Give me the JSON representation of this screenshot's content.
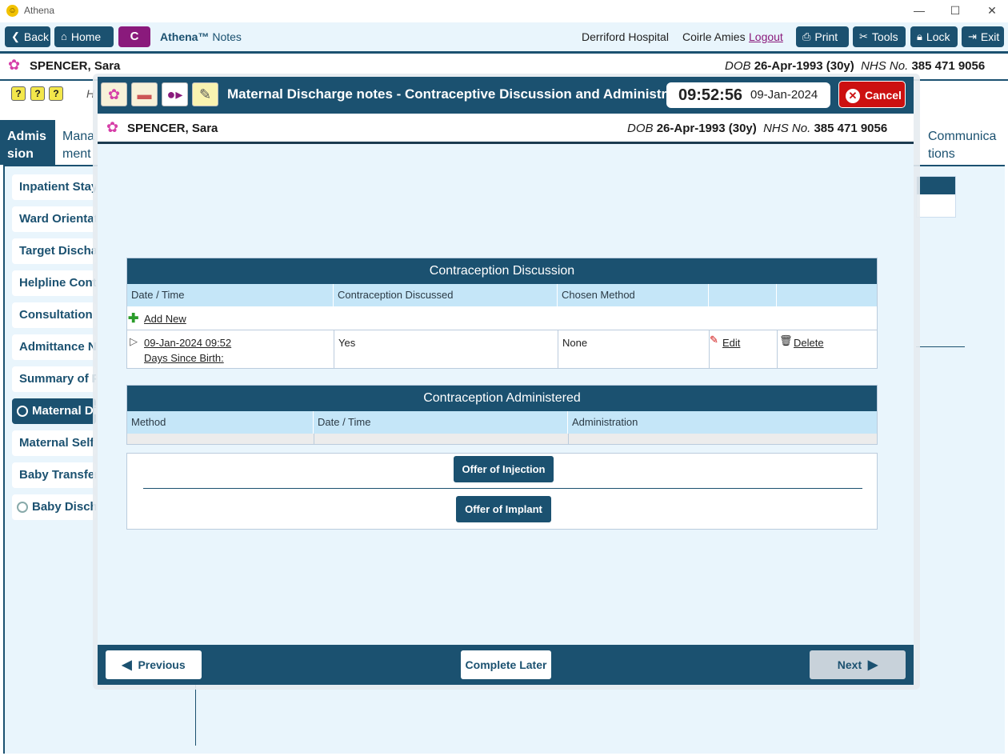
{
  "window": {
    "title": "Athena",
    "minimize": "—",
    "maximize": "☐",
    "close": "✕"
  },
  "toolbar": {
    "back": "Back",
    "home": "Home",
    "c_label": "C",
    "brand": "Athena™",
    "brand_suffix": "Notes",
    "hospital": "Derriford Hospital",
    "user": "Coirle Amies",
    "logout": "Logout",
    "print": "Print",
    "tools": "Tools",
    "lock": "Lock",
    "exit": "Exit"
  },
  "patient": {
    "name": "SPENCER, Sara",
    "dob_label": "DOB",
    "dob": "26-Apr-1993 (30y)",
    "nhs_label": "NHS No.",
    "nhs": "385 471 9056"
  },
  "tabs": {
    "admission": "Admis sion",
    "management": "Mana ment",
    "communications": "Communica tions"
  },
  "behind_heading": "H",
  "sidebar": {
    "items": [
      {
        "label": "Inpatient Stay"
      },
      {
        "label": "Ward Orientat"
      },
      {
        "label": "Target Dischar"
      },
      {
        "label": "Helpline Cont"
      },
      {
        "label": "Consultation I"
      },
      {
        "label": "Admittance N"
      },
      {
        "label": "Summary of P"
      },
      {
        "label": "Maternal Di"
      },
      {
        "label": "Maternal Self"
      },
      {
        "label": "Baby Transfer"
      },
      {
        "label": "Baby Discha"
      }
    ]
  },
  "modal": {
    "title": "Maternal Discharge notes - Contraceptive Discussion and Administration",
    "time": "09:52:56",
    "date": "09-Jan-2024",
    "cancel": "Cancel",
    "discussion": {
      "heading": "Contraception Discussion",
      "columns": [
        "Date / Time",
        "Contraception Discussed",
        "Chosen Method",
        "",
        ""
      ],
      "add_new": "Add New",
      "row": {
        "datetime": "09-Jan-2024 09:52",
        "days_since_birth": "Days Since Birth:",
        "discussed": "Yes",
        "method": "None",
        "edit": "Edit",
        "delete": "Delete"
      }
    },
    "administered": {
      "heading": "Contraception Administered",
      "columns": [
        "Method",
        "Date / Time",
        "Administration"
      ]
    },
    "offer_injection": "Offer of Injection",
    "offer_implant": "Offer of Implant",
    "previous": "Previous",
    "complete_later": "Complete Later",
    "next": "Next"
  },
  "colors": {
    "primary": "#1b5170",
    "accent": "#8a1a7c",
    "cancel": "#cc1010",
    "light": "#e9f5fc",
    "header_row": "#c5e6f8"
  }
}
